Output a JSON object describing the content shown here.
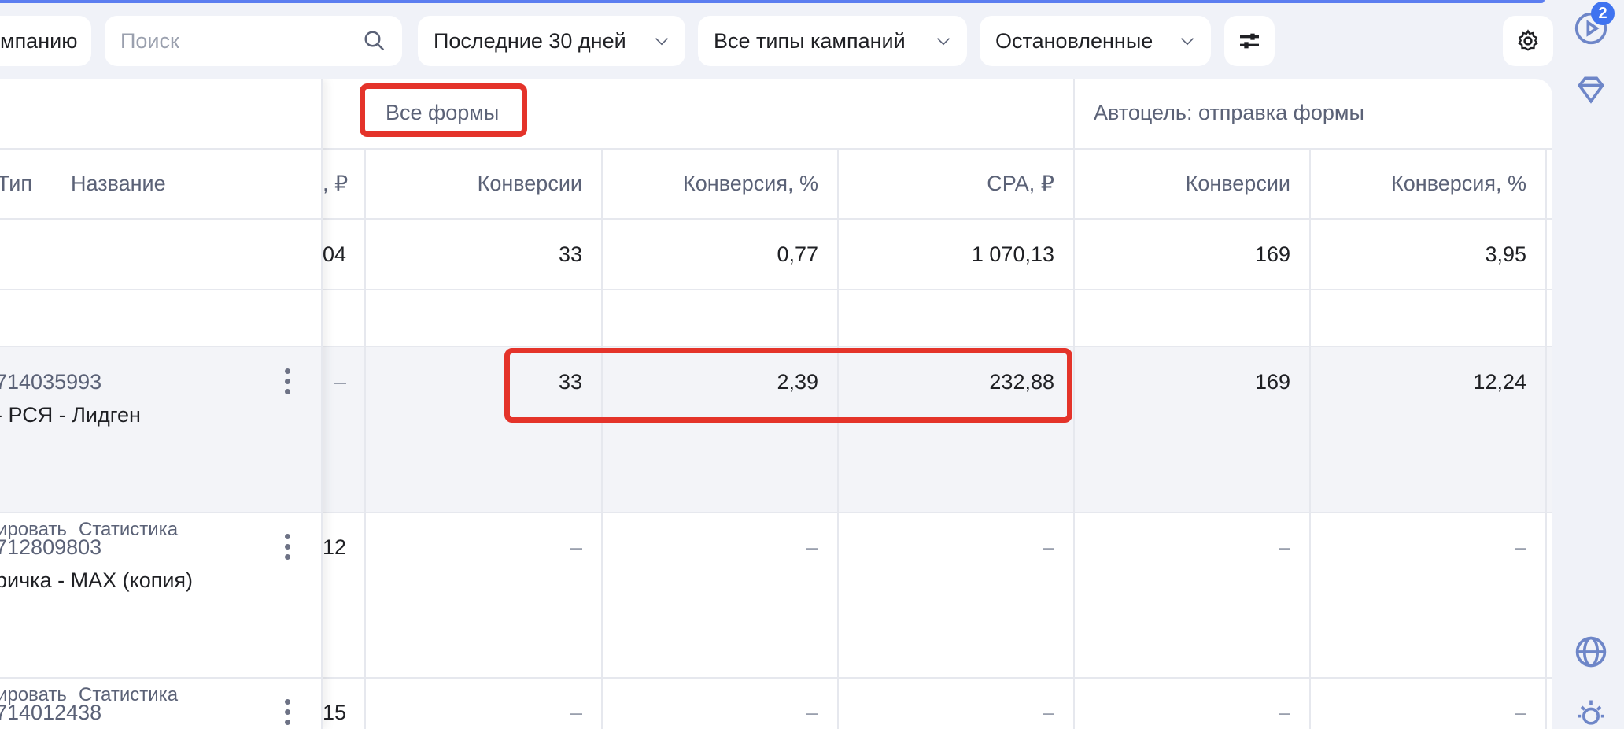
{
  "toolbar": {
    "add_campaign_label": "мпанию",
    "search_placeholder": "Поиск",
    "period_label": "Последние 30 дней",
    "campaign_type_label": "Все типы кампаний",
    "status_label": "Остановленные"
  },
  "rail": {
    "notifications_count": "2"
  },
  "groups": {
    "all_forms": "Все формы",
    "autogoal": "Автоцель: отправка формы"
  },
  "columns": {
    "type": "Тип",
    "name": "Название",
    "cost_partial": ", ₽",
    "conv1": "Конверсии",
    "convpct1": "Конверсия, %",
    "cpa1": "CPA, ₽",
    "conv2": "Конверсии",
    "convpct2": "Конверсия, %"
  },
  "totals": {
    "cost": "04",
    "conv1": "33",
    "convpct1": "0,77",
    "cpa1": "1 070,13",
    "conv2": "169",
    "convpct2": "3,95"
  },
  "rows": [
    {
      "id": "714035993",
      "name": "- РСЯ - Лидген",
      "edit": "ировать",
      "stats": "Статистика",
      "cost": "–",
      "conv1": "33",
      "convpct1": "2,39",
      "cpa1": "232,88",
      "conv2": "169",
      "convpct2": "12,24"
    },
    {
      "id": "712809803",
      "name": "ричка - MAX (копия)",
      "edit": "ировать",
      "stats": "Статистика",
      "cost": "12",
      "conv1": "–",
      "convpct1": "–",
      "cpa1": "–",
      "conv2": "–",
      "convpct2": "–"
    },
    {
      "id": "714012438",
      "cost": "15",
      "conv1": "–",
      "convpct1": "–",
      "cpa1": "–",
      "conv2": "–",
      "convpct2": "–"
    }
  ]
}
